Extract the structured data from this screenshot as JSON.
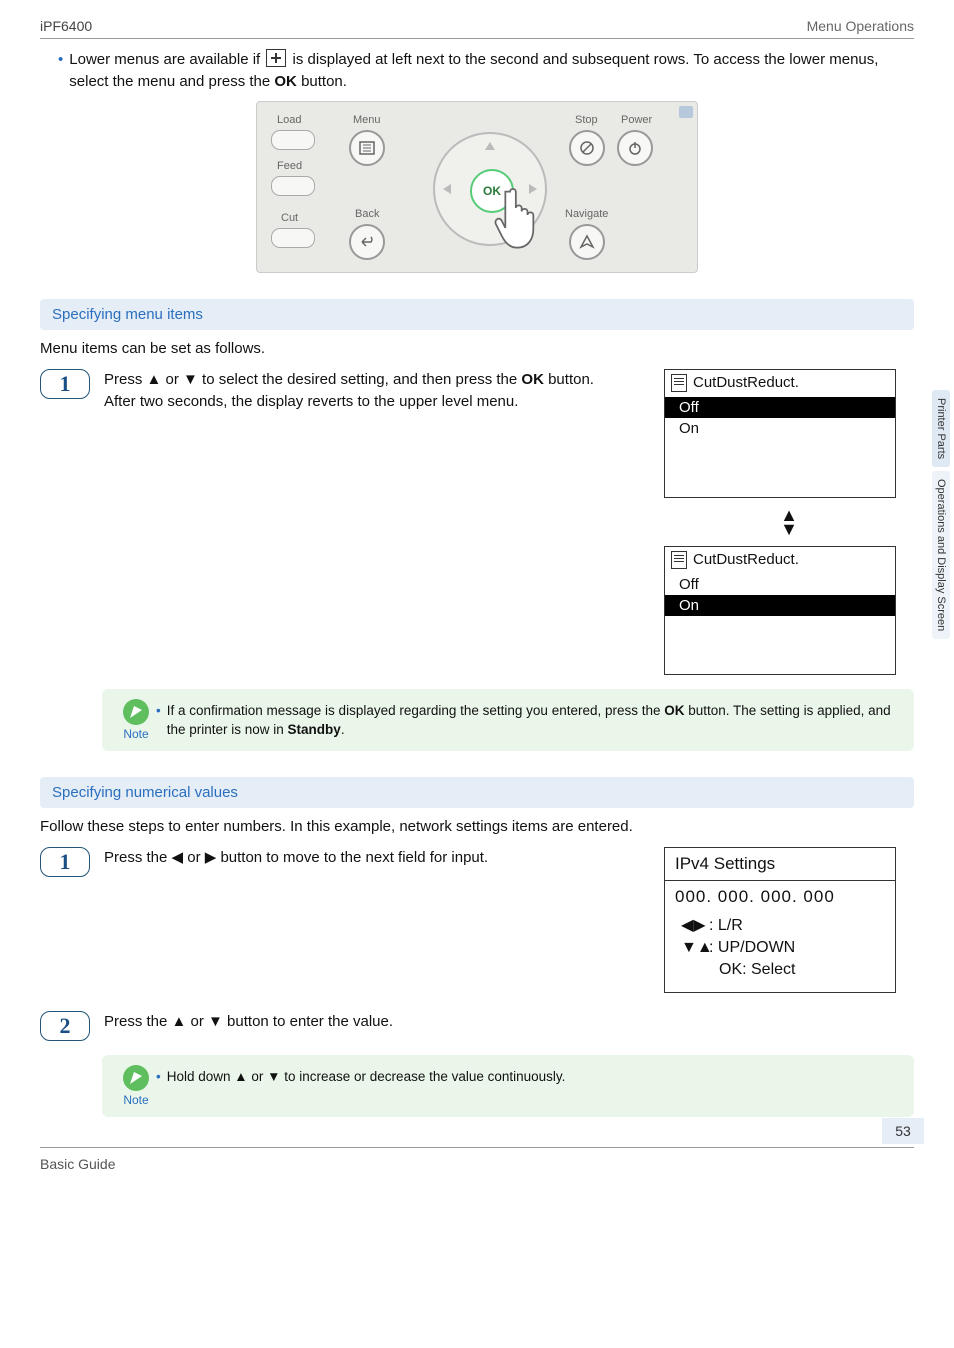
{
  "hdr": {
    "left": "iPF6400",
    "right": "Menu Operations"
  },
  "sidetabs": {
    "a": "Printer Parts",
    "b": "Operations and Display Screen"
  },
  "intro": {
    "line": "Lower menus are available if ",
    "line2": " is displayed at left next to the second and subsequent rows. To access the lower menus, select the menu and press the ",
    "ok": "OK",
    "line3": " button."
  },
  "panel": {
    "load": "Load",
    "feed": "Feed",
    "cut": "Cut",
    "menu": "Menu",
    "back": "Back",
    "stop": "Stop",
    "power": "Power",
    "navigate": "Navigate",
    "ok": "OK"
  },
  "sec1": {
    "title": "Specifying menu items",
    "lead": "Menu items can be set as follows.",
    "step1a": "Press ▲ or ▼ to select the desired setting, and then press the ",
    "ok": "OK",
    "step1b": " button.",
    "step1c": "After two seconds, the display reverts to the upper level menu."
  },
  "lcd": {
    "title": "CutDustReduct.",
    "off": "Off",
    "on": "On"
  },
  "note1": {
    "label": "Note",
    "text1": "If a confirmation message is displayed regarding the setting you entered, press the ",
    "ok": "OK",
    "text2": " button. The setting is applied, and the printer is now in ",
    "standby": "Standby",
    "text3": "."
  },
  "sec2": {
    "title": "Specifying numerical values",
    "lead": "Follow these steps to enter numbers. In this example, network settings items are entered.",
    "step1": "Press the ◀ or ▶ button to move to the next field for input.",
    "step2": "Press the ▲ or ▼ button to enter the value."
  },
  "ipv4": {
    "title": "IPv4 Settings",
    "value": "000. 000. 000. 000",
    "lr": ": L/R",
    "ud": ": UP/DOWN",
    "ok": "OK: Select"
  },
  "note2": {
    "label": "Note",
    "text": "Hold down ▲ or ▼ to increase or decrease the value continuously."
  },
  "steps": {
    "one": "1",
    "two": "2"
  },
  "arrows": {
    "leftTri": "◀",
    "rightTri": "▶",
    "lr": "◀▶",
    "ud": "▼▲"
  },
  "page": "53",
  "footer": "Basic Guide"
}
